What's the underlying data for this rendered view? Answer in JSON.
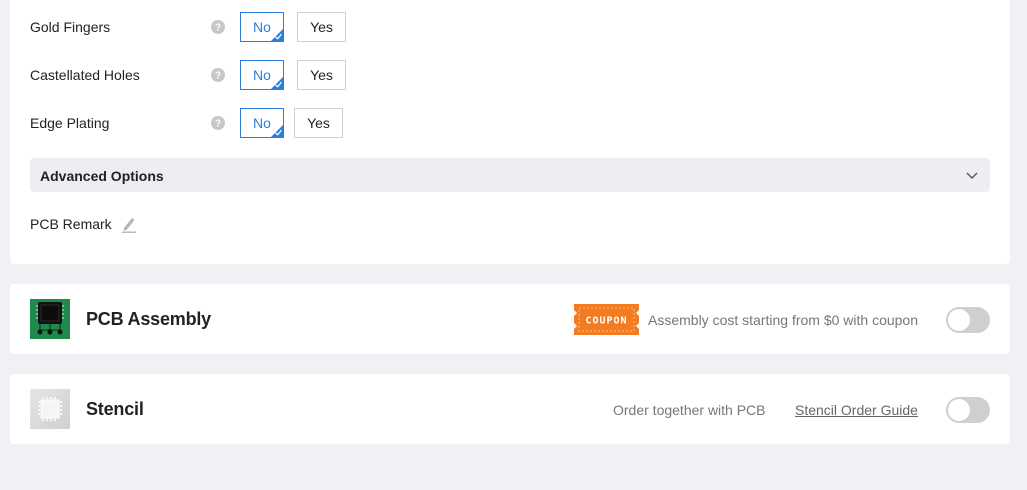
{
  "options": [
    {
      "label": "Gold Fingers",
      "no_label": "No",
      "yes_label": "Yes",
      "selected": "No"
    },
    {
      "label": "Castellated Holes",
      "no_label": "No",
      "yes_label": "Yes",
      "selected": "No"
    },
    {
      "label": "Edge Plating",
      "no_label": "No",
      "yes_label": "Yes",
      "selected": "No"
    }
  ],
  "advanced": {
    "label": "Advanced Options"
  },
  "remark": {
    "label": "PCB Remark"
  },
  "assembly": {
    "title": "PCB Assembly",
    "coupon_text": "COUPON",
    "description": "Assembly cost starting from $0 with coupon",
    "enabled": false
  },
  "stencil": {
    "title": "Stencil",
    "description": "Order together with PCB",
    "guide_link": "Stencil Order Guide",
    "enabled": false
  },
  "colors": {
    "accent": "#2a7fdb",
    "background": "#f0f1f5",
    "coupon": "#f47c20",
    "assembly_icon": "#1f8a4c",
    "switch_off": "#cfcfcf"
  }
}
